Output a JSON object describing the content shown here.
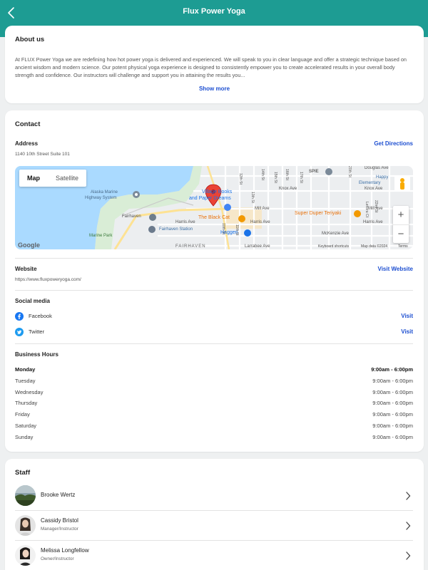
{
  "header": {
    "title": "Flux Power Yoga"
  },
  "about": {
    "title": "About us",
    "text": "At FLUX Power Yoga we are redefining how hot power yoga is delivered and experienced. We will speak to you in clear language and offer a strategic technique based on ancient wisdom and modern science. Our potent physical yoga experience is designed to consistently empower you to create accelerated results in your overall body strength and confidence. Our instructors will challenge and support you in attaining the results you...",
    "show_more": "Show more"
  },
  "contact": {
    "title": "Contact",
    "address_label": "Address",
    "address": "1140 10th Street Suite 101",
    "directions": "Get Directions",
    "map": {
      "map_tab": "Map",
      "satellite_tab": "Satellite",
      "zoom_in": "+",
      "zoom_out": "−",
      "labels": {
        "alaska": "Alaska Marine",
        "alaska2": "Highway System",
        "fairhaven": "Fairhaven",
        "marine_park": "Marine Park",
        "harris": "Harris Ave",
        "harris2": "Harris Ave",
        "harris3": "Harris Ave",
        "station": "Fairhaven Station",
        "fairhaven_caps": "FAIRHAVEN",
        "village_books": "Village Books",
        "paper_dreams": "and Paper Dreams",
        "black_cat": "The Black Cat",
        "haggen": "Haggen",
        "teriyaki": "Super Duper Teriyaki",
        "mill": "Mill Ave",
        "mill2": "Mill Ave",
        "knox": "Knox Ave",
        "knox2": "Knox Ave",
        "spie": "SPIE",
        "mckenzie": "McKenzie Ave",
        "larrabee": "Larrabee Ave",
        "douglas": "Douglas Ave",
        "happy": "Happy",
        "elementary": "Elementary",
        "st12": "12th St",
        "st13": "13th St",
        "st14": "14th St",
        "st15": "15th St",
        "st16": "16th St",
        "st17": "17th St",
        "st10": "10th St",
        "st11": "11th St",
        "st20": "20th St",
        "st22": "22nd St",
        "lenora": "Lenora Ct",
        "google": "Google",
        "shortcuts": "Keyboard shortcuts",
        "mapdata": "Map data ©2024",
        "terms": "Terms"
      }
    },
    "website_label": "Website",
    "website_url": "https://www.fluxpoweryoga.com/",
    "visit_website": "Visit Website",
    "social_label": "Social media",
    "social": [
      {
        "name": "Facebook",
        "action": "Visit"
      },
      {
        "name": "Twitter",
        "action": "Visit"
      }
    ],
    "hours_label": "Business Hours",
    "hours": [
      {
        "day": "Monday",
        "time": "9:00am - 6:00pm"
      },
      {
        "day": "Tuesday",
        "time": "9:00am - 6:00pm"
      },
      {
        "day": "Wednesday",
        "time": "9:00am - 6:00pm"
      },
      {
        "day": "Thursday",
        "time": "9:00am - 6:00pm"
      },
      {
        "day": "Friday",
        "time": "9:00am - 6:00pm"
      },
      {
        "day": "Saturday",
        "time": "9:00am - 6:00pm"
      },
      {
        "day": "Sunday",
        "time": "9:00am - 6:00pm"
      }
    ]
  },
  "staff": {
    "title": "Staff",
    "members": [
      {
        "name": "Brooke Wertz",
        "role": ""
      },
      {
        "name": "Cassidy Bristol",
        "role": "Manager/Instructor"
      },
      {
        "name": "Melissa Longfellow",
        "role": "Owner/Instructor"
      }
    ]
  },
  "colors": {
    "header": "#1d9c93",
    "link": "#1d4fd1",
    "water": "#aadaff",
    "pin": "#ea4335"
  }
}
